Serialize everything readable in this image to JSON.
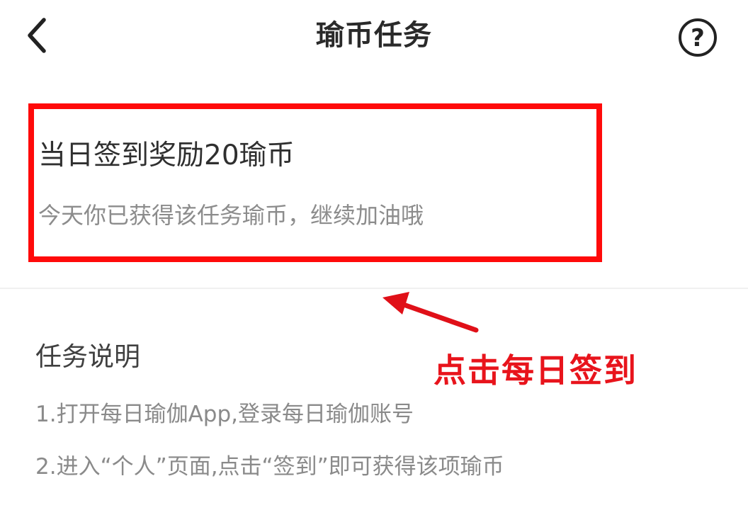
{
  "header": {
    "title": "瑜币任务",
    "help_label": "?"
  },
  "task": {
    "title": "当日签到奖励20瑜币",
    "subtitle": "今天你已获得该任务瑜币，继续加油哦"
  },
  "annotation": {
    "label": "点击每日签到",
    "color": "#e8141c"
  },
  "section": {
    "title": "任务说明",
    "items": [
      "1.打开每日瑜伽App,登录每日瑜伽账号",
      "2.进入“个人”页面,点击“签到”即可获得该项瑜币"
    ]
  },
  "icons": {
    "back": "chevron-left-icon",
    "help": "question-circle-icon",
    "arrow": "arrow-icon"
  },
  "colors": {
    "highlight": "#ff0a0a",
    "text_primary": "#2f2f2f",
    "text_secondary": "#8c8c8c"
  }
}
